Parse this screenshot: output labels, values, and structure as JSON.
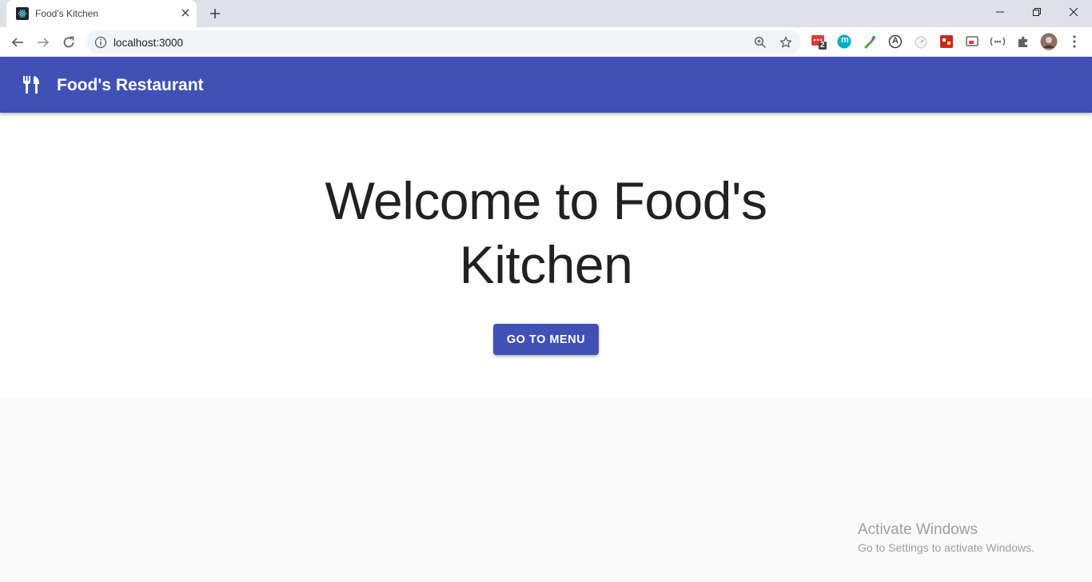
{
  "browser": {
    "tab_title": "Food's Kitchen",
    "url": "localhost:3000",
    "extension_badge": "2",
    "extension_letter_m": "m",
    "extension_letter_a": "A"
  },
  "app": {
    "title": "Food's Restaurant"
  },
  "hero": {
    "heading": "Welcome to Food's Kitchen",
    "button_label": "GO TO MENU"
  },
  "watermark": {
    "title": "Activate Windows",
    "subtitle": "Go to Settings to activate Windows."
  },
  "colors": {
    "primary": "#3f51b5",
    "tabstrip": "#dee1e6",
    "page_background": "#fafafa"
  },
  "icons": [
    "react-favicon-icon",
    "close-icon",
    "plus-icon",
    "minimize-icon",
    "restore-icon",
    "window-close-icon",
    "back-icon",
    "forward-icon",
    "reload-icon",
    "info-icon",
    "zoom-icon",
    "star-icon",
    "extensions-puzzle-icon",
    "profile-avatar",
    "menu-dots-icon",
    "restaurant-icon"
  ]
}
